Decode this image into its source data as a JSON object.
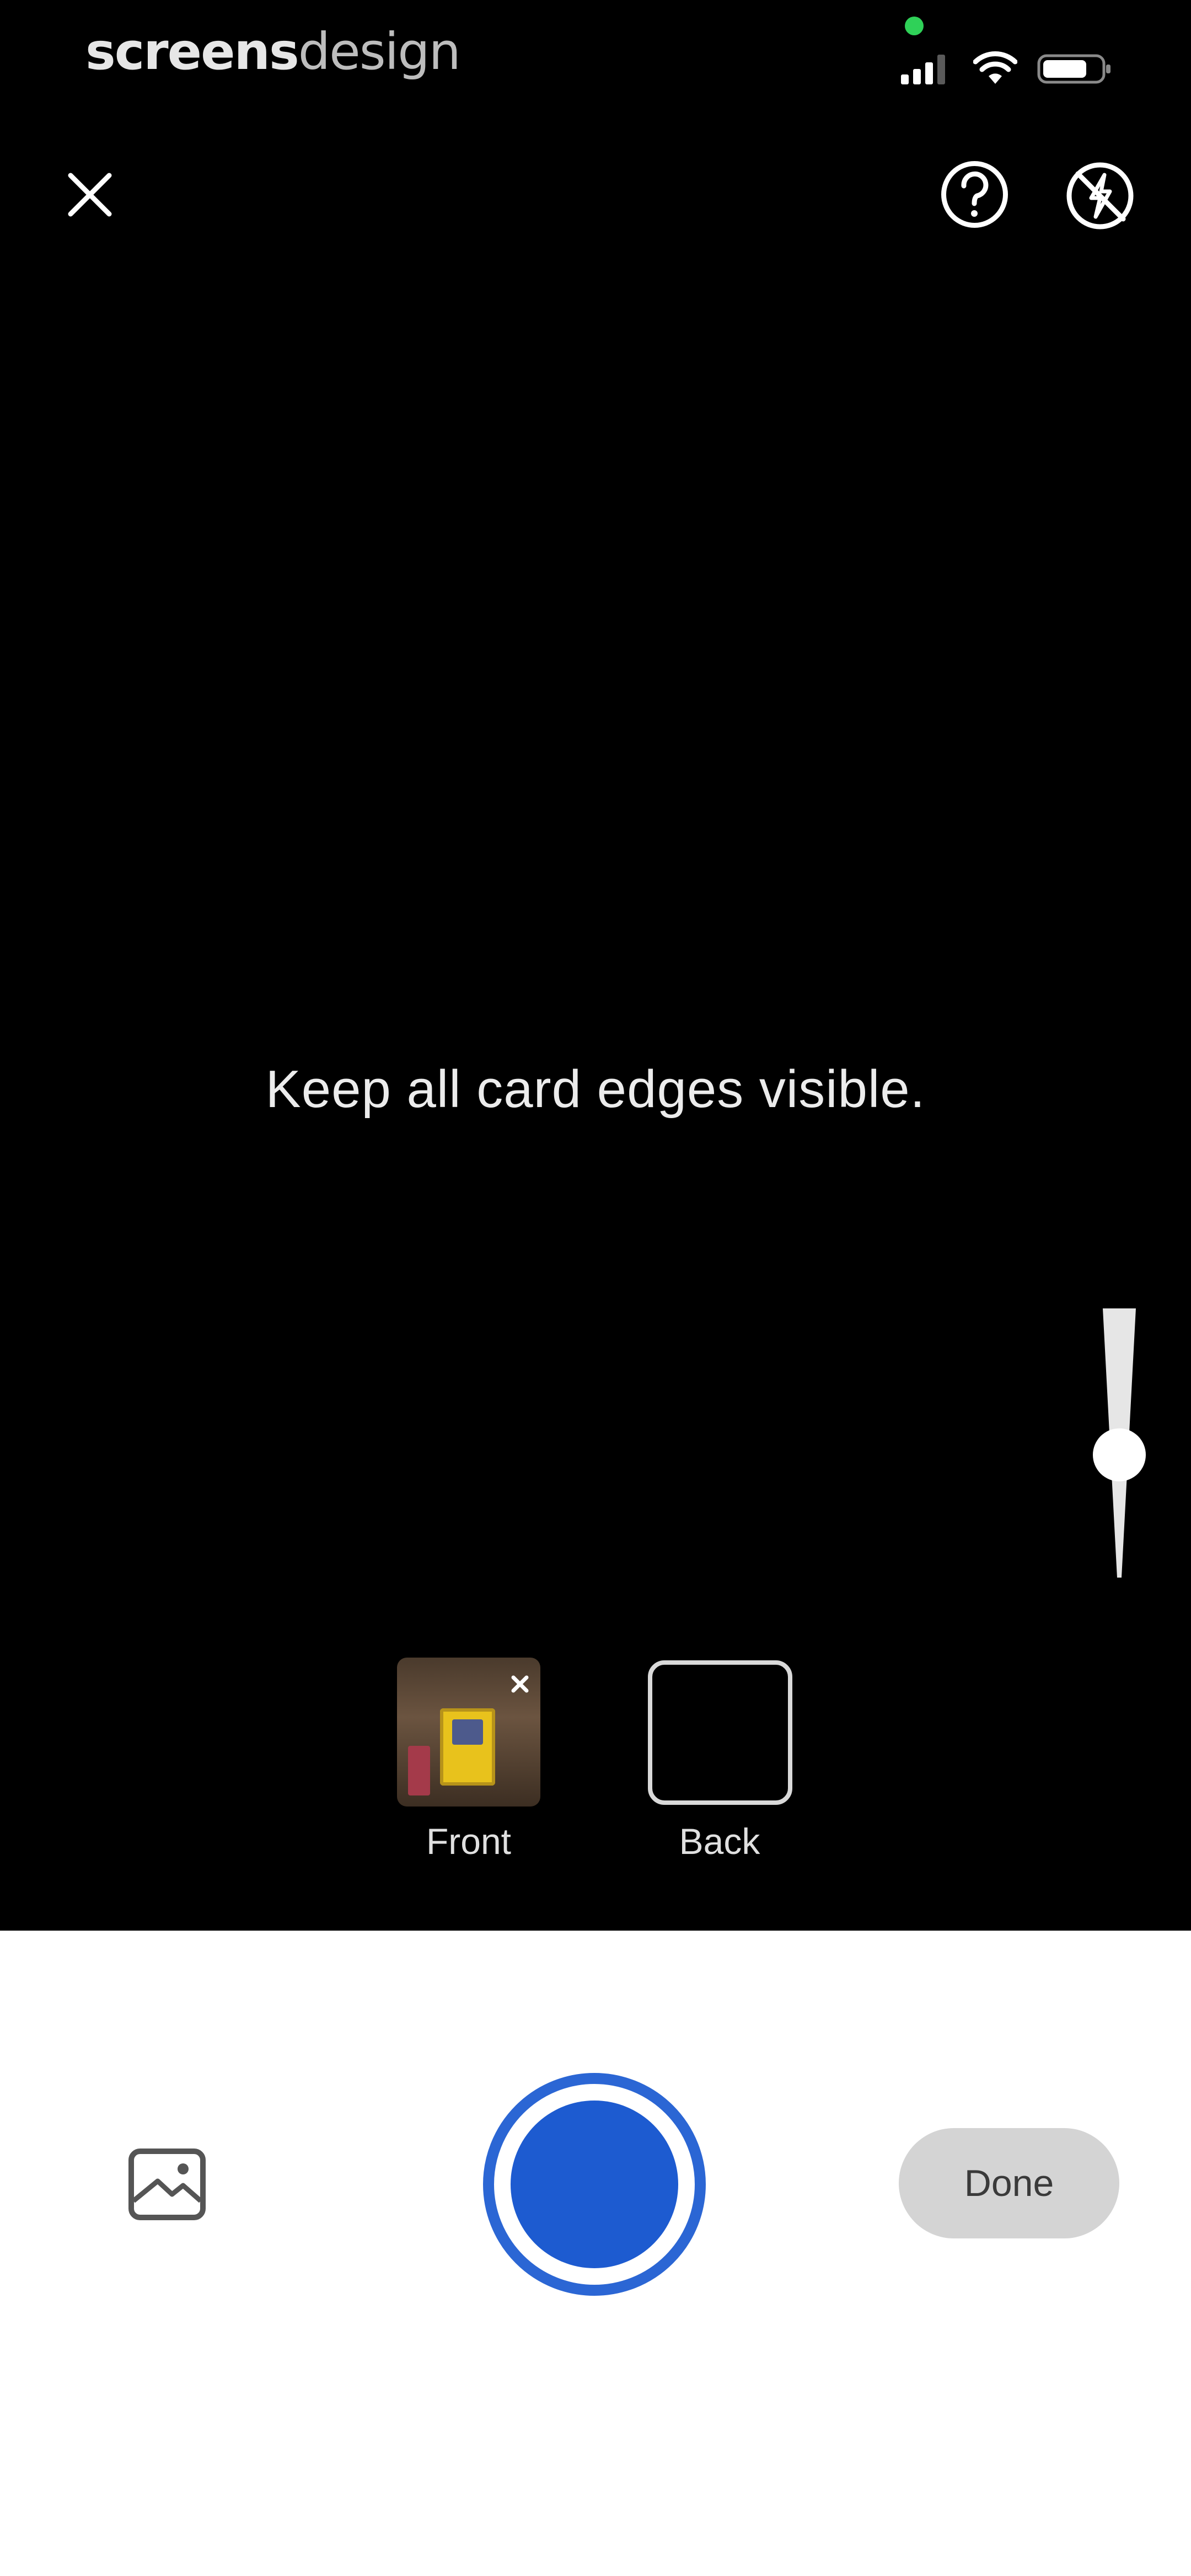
{
  "status_bar": {
    "brand_bold": "screens",
    "brand_light": "design",
    "icons": [
      "privacy-indicator-dot",
      "cellular-signal-icon",
      "wifi-icon",
      "battery-icon"
    ]
  },
  "top_controls": {
    "close_icon": "close-icon",
    "help_icon": "question-circle-icon",
    "flash_icon": "flash-off-icon"
  },
  "viewfinder": {
    "instruction": "Keep all card edges visible."
  },
  "zoom": {
    "level": 0.45
  },
  "capture_sides": [
    {
      "label": "Front",
      "captured": true
    },
    {
      "label": "Back",
      "captured": false
    }
  ],
  "bottom_bar": {
    "gallery_icon": "image-gallery-icon",
    "done_label": "Done"
  },
  "colors": {
    "accent": "#1d5bd0",
    "shutter_ring": "#2b66d4",
    "done_button_bg": "#d4d4d4",
    "viewfinder_bg": "#000000",
    "panel_bg": "#ffffff"
  }
}
